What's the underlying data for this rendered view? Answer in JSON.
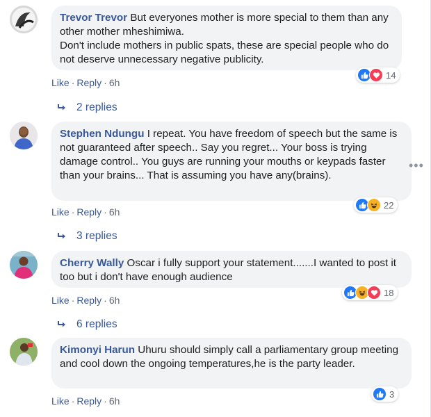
{
  "comments": [
    {
      "author": "Trevor Trevor",
      "text": "But everyones mother is more special to them than any other mother mheshimiwa.\nDon't include mothers in public spats, these are special people who do not deserve unnecessary negative publicity.",
      "reactions": [
        "like",
        "love"
      ],
      "reaction_count": "14",
      "like_label": "Like",
      "reply_label": "Reply",
      "time": "6h",
      "replies_label": "2 replies"
    },
    {
      "author": "Stephen Ndungu",
      "text": "I repeat. You have freedom of speech but the same is not guaranteed after speech.. Say you regret... Your boss is trying damage control.. You guys are running your mouths or keypads faster than your brains... That is assuming you have any(brains).",
      "reactions": [
        "like",
        "haha"
      ],
      "reaction_count": "22",
      "like_label": "Like",
      "reply_label": "Reply",
      "time": "6h",
      "replies_label": "3 replies"
    },
    {
      "author": "Cherry Wally",
      "text": "Oscar i fully support your statement.......I wanted to post it too but i don't have enough audience",
      "reactions": [
        "like",
        "haha",
        "love"
      ],
      "reaction_count": "18",
      "like_label": "Like",
      "reply_label": "Reply",
      "time": "6h",
      "replies_label": "6 replies"
    },
    {
      "author": "Kimonyi Harun",
      "text": "Uhuru should simply call a parliamentary group meeting and cool down the ongoing temperatures,he is the party leader.",
      "reactions": [
        "like"
      ],
      "reaction_count": "3",
      "like_label": "Like",
      "reply_label": "Reply",
      "time": "6h"
    }
  ],
  "colors": {
    "link": "#385898",
    "like": "#2078f4",
    "love": "#f33e58",
    "haha": "#f7b125",
    "bubble": "#f2f3f5"
  },
  "icons": {
    "more": "more-options-icon",
    "reply_arrow": "reply-arrow-icon"
  },
  "more_glyph": "•••"
}
